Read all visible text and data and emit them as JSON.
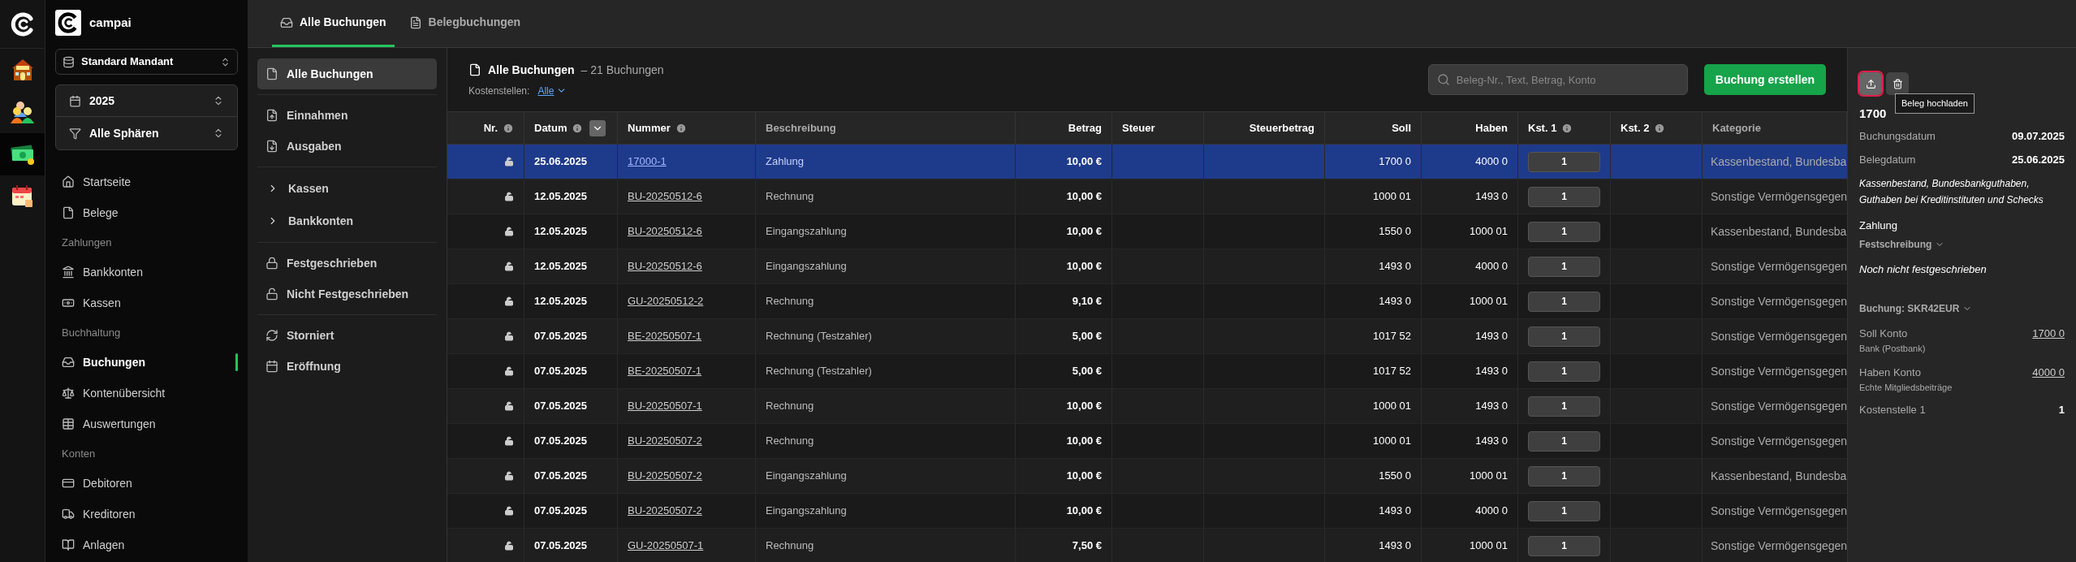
{
  "rail": {
    "apps": [
      {
        "selected": false
      },
      {
        "selected": false
      },
      {
        "selected": true
      },
      {
        "selected": false
      }
    ]
  },
  "sidebar": {
    "brand": "campai",
    "mandant": "Standard Mandant",
    "year": "2025",
    "sphere": "Alle Sphären",
    "nav": [
      {
        "kind": "item",
        "label": "Startseite",
        "selected": false
      },
      {
        "kind": "item",
        "label": "Belege",
        "selected": false
      },
      {
        "kind": "header",
        "label": "Zahlungen"
      },
      {
        "kind": "item",
        "label": "Bankkonten",
        "selected": false
      },
      {
        "kind": "item",
        "label": "Kassen",
        "selected": false
      },
      {
        "kind": "header",
        "label": "Buchhaltung"
      },
      {
        "kind": "item",
        "label": "Buchungen",
        "selected": true
      },
      {
        "kind": "item",
        "label": "Kontenübersicht",
        "selected": false
      },
      {
        "kind": "item",
        "label": "Auswertungen",
        "selected": false
      },
      {
        "kind": "header",
        "label": "Konten"
      },
      {
        "kind": "item",
        "label": "Debitoren",
        "selected": false
      },
      {
        "kind": "item",
        "label": "Kreditoren",
        "selected": false
      },
      {
        "kind": "item",
        "label": "Anlagen",
        "selected": false
      }
    ]
  },
  "tabs": [
    {
      "label": "Alle Buchungen",
      "selected": true
    },
    {
      "label": "Belegbuchungen",
      "selected": false
    }
  ],
  "subnav": [
    {
      "items": [
        {
          "kind": "link",
          "label": "Alle Buchungen",
          "selected": true
        }
      ]
    },
    {
      "items": [
        {
          "kind": "link",
          "label": "Einnahmen",
          "selected": false
        },
        {
          "kind": "link",
          "label": "Ausgaben",
          "selected": false
        }
      ]
    },
    {
      "items": [
        {
          "kind": "expander",
          "label": "Kassen",
          "expanded": false
        },
        {
          "kind": "expander",
          "label": "Bankkonten",
          "expanded": false
        }
      ]
    },
    {
      "items": [
        {
          "kind": "link",
          "label": "Festgeschrieben",
          "selected": false
        },
        {
          "kind": "link",
          "label": "Nicht Festgeschrieben",
          "selected": false
        }
      ]
    },
    {
      "items": [
        {
          "kind": "link",
          "label": "Storniert",
          "selected": false
        },
        {
          "kind": "link",
          "label": "Eröffnung",
          "selected": false
        }
      ]
    }
  ],
  "header": {
    "title": "Alle Buchungen",
    "count": "– 21 Buchungen",
    "filter_label": "Kostenstellen:",
    "filter_value": "Alle",
    "search": {
      "placeholder": "Beleg-Nr., Text, Betrag, Konto"
    },
    "create_button": "Buchung erstellen"
  },
  "table": {
    "columns": [
      {
        "label": "Nr.",
        "info": true,
        "numeric": true,
        "sortable": true
      },
      {
        "label": "Datum",
        "info": true,
        "numeric": false,
        "sortable": true,
        "sort_menu": true
      },
      {
        "label": "Nummer",
        "info": true,
        "numeric": false,
        "sortable": true
      },
      {
        "label": "Beschreibung",
        "info": false,
        "numeric": false,
        "sortable": false
      },
      {
        "label": "Betrag",
        "info": false,
        "numeric": true,
        "sortable": true
      },
      {
        "label": "Steuer",
        "info": false,
        "numeric": false,
        "sortable": true
      },
      {
        "label": "Steuerbetrag",
        "info": false,
        "numeric": true,
        "sortable": true
      },
      {
        "label": "Soll",
        "info": false,
        "numeric": true,
        "sortable": true
      },
      {
        "label": "Haben",
        "info": false,
        "numeric": true,
        "sortable": true
      },
      {
        "label": "Kst. 1",
        "info": true,
        "numeric": false,
        "sortable": true
      },
      {
        "label": "Kst. 2",
        "info": true,
        "numeric": false,
        "sortable": true
      },
      {
        "label": "Kategorie",
        "info": false,
        "numeric": false,
        "sortable": false
      }
    ],
    "rows": [
      {
        "selected": true,
        "locked": false,
        "date": "25.06.2025",
        "number": "17000-1",
        "description": "Zahlung",
        "amount": "10,00 €",
        "soll": "1700 0",
        "haben": "4000 0",
        "kst1": "1",
        "category": "Kassenbestand, Bundesba"
      },
      {
        "selected": false,
        "locked": false,
        "date": "12.05.2025",
        "number": "BU-20250512-6",
        "description": "Rechnung",
        "amount": "10,00 €",
        "soll": "1000 01",
        "haben": "1493 0",
        "kst1": "1",
        "category": "Sonstige Vermögensgegen"
      },
      {
        "selected": false,
        "locked": false,
        "date": "12.05.2025",
        "number": "BU-20250512-6",
        "description": "Eingangszahlung",
        "amount": "10,00 €",
        "soll": "1550 0",
        "haben": "1000 01",
        "kst1": "1",
        "category": "Kassenbestand, Bundesba"
      },
      {
        "selected": false,
        "locked": false,
        "date": "12.05.2025",
        "number": "BU-20250512-6",
        "description": "Eingangszahlung",
        "amount": "10,00 €",
        "soll": "1493 0",
        "haben": "4000 0",
        "kst1": "1",
        "category": "Sonstige Vermögensgegen"
      },
      {
        "selected": false,
        "locked": false,
        "date": "12.05.2025",
        "number": "GU-20250512-2",
        "description": "Rechnung",
        "amount": "9,10 €",
        "soll": "1493 0",
        "haben": "1000 01",
        "kst1": "1",
        "category": "Sonstige Vermögensgegen"
      },
      {
        "selected": false,
        "locked": false,
        "date": "07.05.2025",
        "number": "BE-20250507-1",
        "description": "Rechnung (Testzahler)",
        "amount": "5,00 €",
        "soll": "1017 52",
        "haben": "1493 0",
        "kst1": "1",
        "category": "Sonstige Vermögensgegen"
      },
      {
        "selected": false,
        "locked": false,
        "date": "07.05.2025",
        "number": "BE-20250507-1",
        "description": "Rechnung (Testzahler)",
        "amount": "5,00 €",
        "soll": "1017 52",
        "haben": "1493 0",
        "kst1": "1",
        "category": "Sonstige Vermögensgegen"
      },
      {
        "selected": false,
        "locked": false,
        "date": "07.05.2025",
        "number": "BU-20250507-1",
        "description": "Rechnung",
        "amount": "10,00 €",
        "soll": "1000 01",
        "haben": "1493 0",
        "kst1": "1",
        "category": "Sonstige Vermögensgegen"
      },
      {
        "selected": false,
        "locked": false,
        "date": "07.05.2025",
        "number": "BU-20250507-2",
        "description": "Rechnung",
        "amount": "10,00 €",
        "soll": "1000 01",
        "haben": "1493 0",
        "kst1": "1",
        "category": "Sonstige Vermögensgegen"
      },
      {
        "selected": false,
        "locked": false,
        "date": "07.05.2025",
        "number": "BU-20250507-2",
        "description": "Eingangszahlung",
        "amount": "10,00 €",
        "soll": "1550 0",
        "haben": "1000 01",
        "kst1": "1",
        "category": "Kassenbestand, Bundesba"
      },
      {
        "selected": false,
        "locked": false,
        "date": "07.05.2025",
        "number": "BU-20250507-2",
        "description": "Eingangszahlung",
        "amount": "10,00 €",
        "soll": "1493 0",
        "haben": "4000 0",
        "kst1": "1",
        "category": "Sonstige Vermögensgegen"
      },
      {
        "selected": false,
        "locked": false,
        "date": "07.05.2025",
        "number": "GU-20250507-1",
        "description": "Rechnung",
        "amount": "7,50 €",
        "soll": "1493 0",
        "haben": "1000 01",
        "kst1": "1",
        "category": "Sonstige Vermögensgegen"
      }
    ]
  },
  "details": {
    "tooltip": "Beleg hochladen",
    "title": "1700",
    "dates": [
      {
        "label": "Buchungsdatum",
        "value": "09.07.2025"
      },
      {
        "label": "Belegdatum",
        "value": "25.06.2025"
      }
    ],
    "category": "Kassenbestand, Bundesbankguthaben, Guthaben bei Kreditinstituten und Schecks",
    "type": "Zahlung",
    "lock_section": {
      "label": "Festschreibung",
      "expanded": false
    },
    "lock_status": "Noch nicht festgeschrieben",
    "booking_section": {
      "label": "Buchung: SKR42EUR",
      "expanded": false
    },
    "accounts": [
      {
        "label": "Soll Konto",
        "sub": "Bank (Postbank)",
        "value": "1700 0"
      },
      {
        "label": "Haben Konto",
        "sub": "Echte Mitgliedsbeiträge",
        "value": "4000 0"
      }
    ],
    "cost_center": {
      "label": "Kostenstelle 1",
      "value": "1"
    }
  }
}
